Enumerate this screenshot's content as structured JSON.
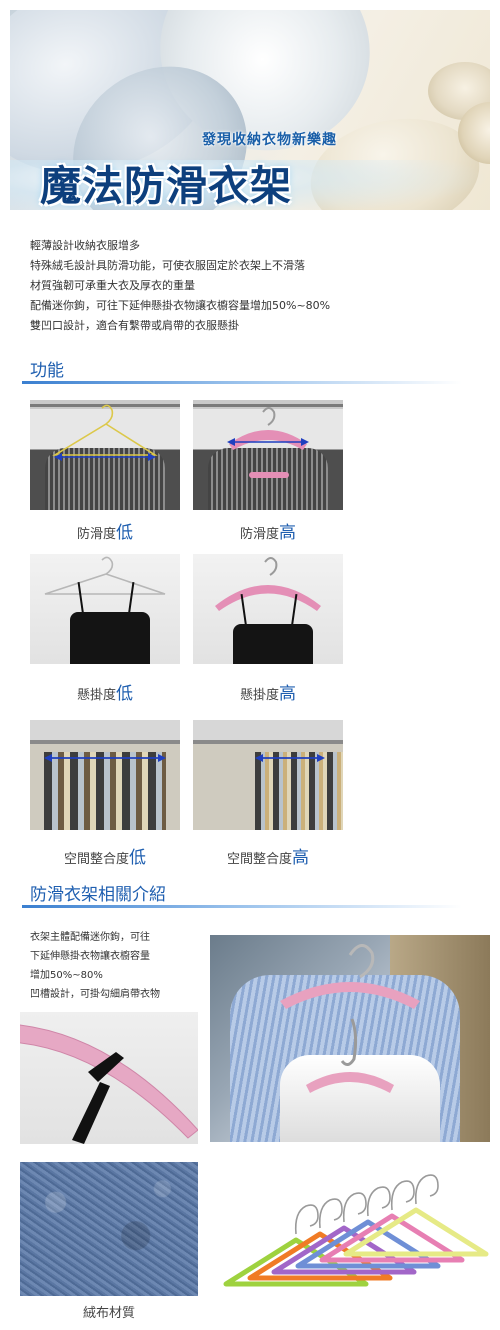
{
  "banner": {
    "subtitle": "發現收納衣物新樂趣",
    "title": "魔法防滑衣架"
  },
  "intro": {
    "lines": [
      "輕薄設計收納衣服增多",
      "特殊絨毛設計具防滑功能，可使衣服固定於衣架上不滑落",
      "材質強韌可承重大衣及厚衣的重量",
      "配備迷你鉤，可往下延伸懸掛衣物讓衣櫥容量增加50%~80%",
      "雙凹口設計，適合有繫帶或肩帶的衣服懸掛"
    ]
  },
  "features": {
    "title": "功能",
    "comparisons": [
      {
        "left": {
          "label": "防滑度",
          "level": "低"
        },
        "right": {
          "label": "防滑度",
          "level": "高"
        }
      },
      {
        "left": {
          "label": "懸掛度",
          "level": "低"
        },
        "right": {
          "label": "懸掛度",
          "level": "高"
        }
      },
      {
        "left": {
          "label": "空間整合度",
          "level": "低"
        },
        "right": {
          "label": "空間整合度",
          "level": "高"
        }
      }
    ]
  },
  "intro2": {
    "title": "防滑衣架相關介紹",
    "lines": [
      "衣架主體配備迷你鉤，可往",
      "下延伸懸掛衣物讓衣櫥容量",
      "增加50%~80%",
      "凹槽設計，可掛勾細肩帶衣物"
    ],
    "fabric_caption": "絨布材質"
  },
  "colors": {
    "accent": "#1f5fb0",
    "pink_hanger": "#e48fb6",
    "wire_hanger": "#dcc84a",
    "arrow": "#1f3fbf",
    "hanger_palette": [
      "#9ed23f",
      "#f07b25",
      "#a266c8",
      "#6f8fd6",
      "#e77fb3",
      "#e6ea86"
    ]
  }
}
